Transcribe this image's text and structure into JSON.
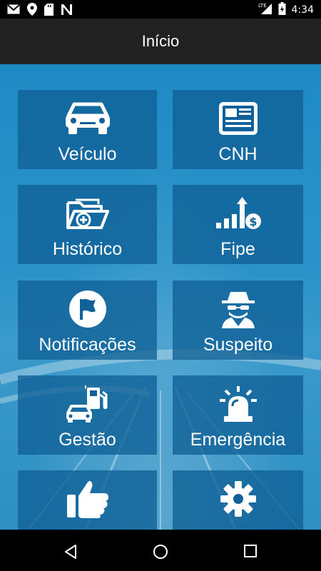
{
  "status_bar": {
    "icons": [
      "gmail-icon",
      "location-icon",
      "sd-card-icon",
      "n-app-icon",
      "lte-signal-icon",
      "battery-icon"
    ],
    "network": "LTE",
    "time": "4:34"
  },
  "app_bar": {
    "title": "Início"
  },
  "menu": {
    "items": [
      {
        "label": "Veículo",
        "icon": "car-icon"
      },
      {
        "label": "CNH",
        "icon": "newspaper-icon"
      },
      {
        "label": "Histórico",
        "icon": "folder-plus-icon"
      },
      {
        "label": "Fipe",
        "icon": "price-chart-icon"
      },
      {
        "label": "Notificações",
        "icon": "flag-icon"
      },
      {
        "label": "Suspeito",
        "icon": "spy-icon"
      },
      {
        "label": "Gestão",
        "icon": "fuel-car-icon"
      },
      {
        "label": "Emergência",
        "icon": "siren-icon"
      },
      {
        "label": "",
        "icon": "thumbs-up-icon"
      },
      {
        "label": "",
        "icon": "gear-icon"
      }
    ]
  },
  "colors": {
    "tile": "#10609a",
    "background": "#2b93c9",
    "app_bar": "#222222"
  }
}
